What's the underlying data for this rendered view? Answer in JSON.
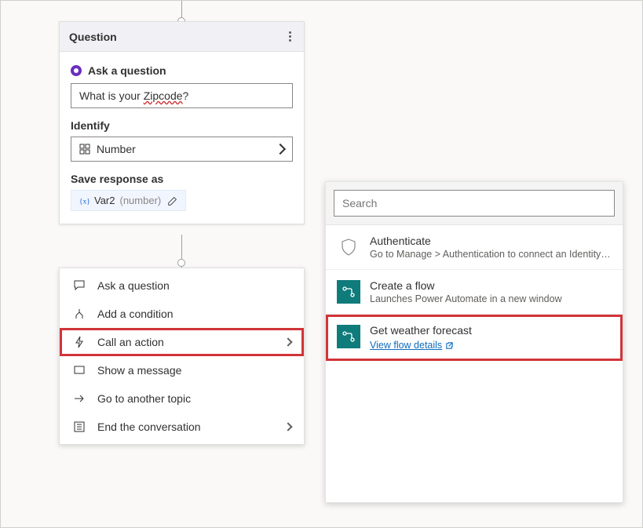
{
  "node": {
    "title": "Question",
    "ask_label": "Ask a question",
    "question_text": "What is your Zipcode?",
    "question_prefix": "What is your ",
    "question_zip": "Zipcode",
    "question_suffix": "?",
    "identify_label": "Identify",
    "identify_value": "Number",
    "save_label": "Save response as",
    "var_name": "Var2",
    "var_type": "(number)"
  },
  "menu": {
    "items": [
      {
        "label": "Ask a question"
      },
      {
        "label": "Add a condition"
      },
      {
        "label": "Call an action"
      },
      {
        "label": "Show a message"
      },
      {
        "label": "Go to another topic"
      },
      {
        "label": "End the conversation"
      }
    ]
  },
  "flyout": {
    "search_placeholder": "Search",
    "items": [
      {
        "title": "Authenticate",
        "subtitle": "Go to Manage > Authentication to connect an Identity…"
      },
      {
        "title": "Create a flow",
        "subtitle": "Launches Power Automate in a new window"
      },
      {
        "title": "Get weather forecast",
        "link": "View flow details"
      }
    ]
  }
}
